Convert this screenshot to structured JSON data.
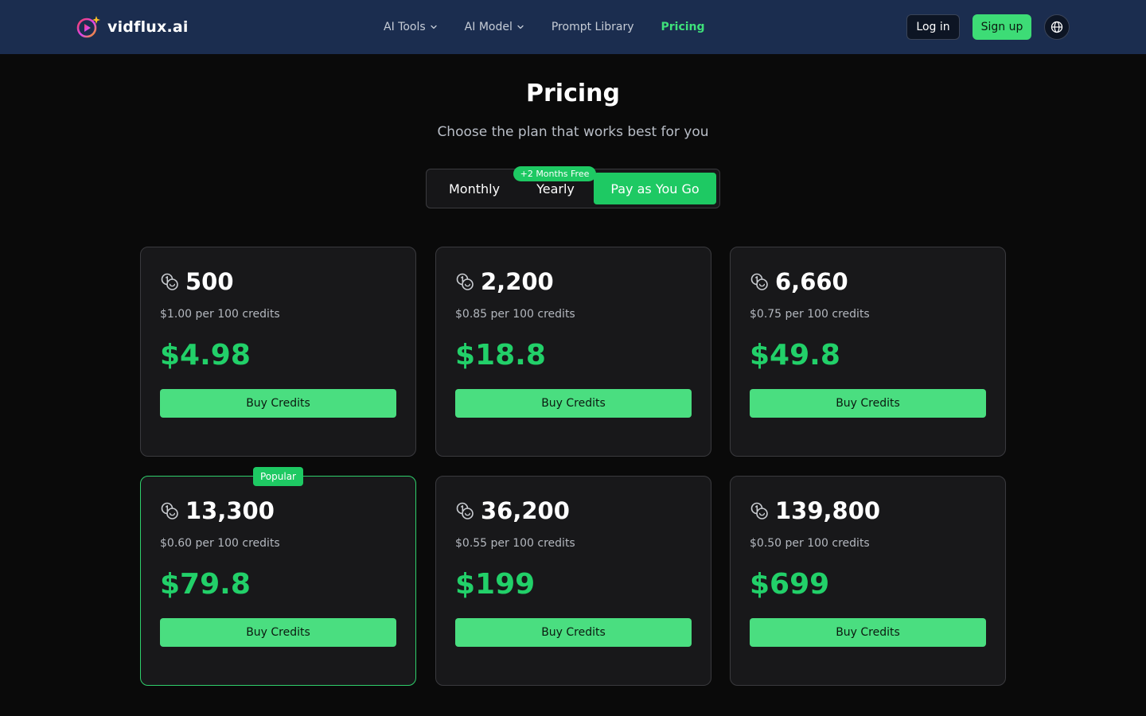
{
  "brand": {
    "name": "vidflux.ai",
    "logo_icon": "play-sparkle-logo-icon",
    "accent": "#3ddc76",
    "header_bg": "#1b2d4f"
  },
  "nav": {
    "items": [
      {
        "label": "AI Tools",
        "has_dropdown": true,
        "icon": "chevron-down-icon"
      },
      {
        "label": "AI Model",
        "has_dropdown": true,
        "icon": "chevron-down-icon"
      },
      {
        "label": "Prompt Library",
        "has_dropdown": false
      },
      {
        "label": "Pricing",
        "has_dropdown": false,
        "active": true
      }
    ],
    "login_label": "Log in",
    "signup_label": "Sign up",
    "language_icon": "globe-icon"
  },
  "hero": {
    "title": "Pricing",
    "subtitle": "Choose the plan that works best for you"
  },
  "billing": {
    "options": [
      "Monthly",
      "Yearly",
      "Pay as You Go"
    ],
    "selected": "Pay as You Go",
    "yearly_badge": "+2 Months Free"
  },
  "plans": {
    "coin_icon": "coins-icon",
    "popular_badge": "Popular",
    "items": [
      {
        "credits": "500",
        "unit_price": "$1.00 per 100 credits",
        "price": "$4.98",
        "button": "Buy Credits",
        "popular": false
      },
      {
        "credits": "2,200",
        "unit_price": "$0.85 per 100 credits",
        "price": "$18.8",
        "button": "Buy Credits",
        "popular": false
      },
      {
        "credits": "6,660",
        "unit_price": "$0.75 per 100 credits",
        "price": "$49.8",
        "button": "Buy Credits",
        "popular": false
      },
      {
        "credits": "13,300",
        "unit_price": "$0.60 per 100 credits",
        "price": "$79.8",
        "button": "Buy Credits",
        "popular": true
      },
      {
        "credits": "36,200",
        "unit_price": "$0.55 per 100 credits",
        "price": "$199",
        "button": "Buy Credits",
        "popular": false
      },
      {
        "credits": "139,800",
        "unit_price": "$0.50 per 100 credits",
        "price": "$699",
        "button": "Buy Credits",
        "popular": false
      }
    ]
  }
}
